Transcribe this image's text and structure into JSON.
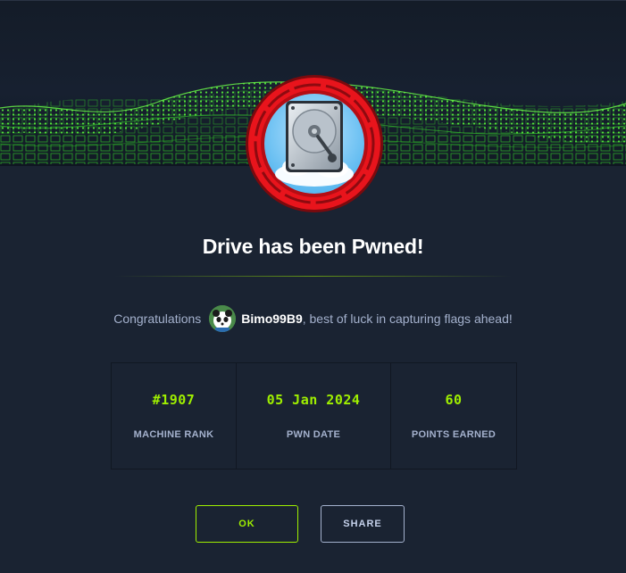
{
  "modal": {
    "title": "Drive has been Pwned!",
    "congrats_prefix": "Congratulations",
    "username": "Bimo99B9",
    "congrats_suffix": ", best of luck in capturing flags ahead!"
  },
  "stats": [
    {
      "value": "#1907",
      "label": "MACHINE RANK"
    },
    {
      "value": "05 Jan 2024",
      "label": "PWN DATE"
    },
    {
      "value": "60",
      "label": "POINTS EARNED"
    }
  ],
  "buttons": {
    "ok_label": "OK",
    "share_label": "SHARE"
  },
  "colors": {
    "accent": "#9fef00",
    "background": "#1a2332",
    "badge_ring": "#e8141c",
    "muted_text": "#a4b1cd"
  },
  "icons": {
    "badge": "hard-drive-icon",
    "avatar": "panda-avatar"
  }
}
